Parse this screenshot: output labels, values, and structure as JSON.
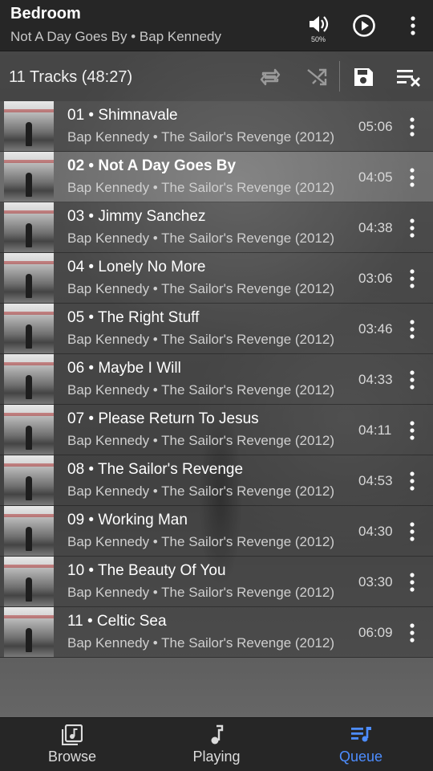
{
  "header": {
    "room": "Bedroom",
    "now_playing": "Not A Day Goes By • Bap Kennedy",
    "volume_percent": "50%",
    "icons": [
      "volume-icon",
      "play-icon",
      "more-vert-icon"
    ]
  },
  "queue": {
    "summary": "11 Tracks (48:27)",
    "icons": [
      "repeat-icon",
      "shuffle-icon",
      "save-icon",
      "clear-queue-icon"
    ]
  },
  "tracks": [
    {
      "title": "01 • Shimnavale",
      "subtitle": "Bap Kennedy • The Sailor's Revenge (2012)",
      "duration": "05:06"
    },
    {
      "title": "02 • Not A Day Goes By",
      "subtitle": "Bap Kennedy • The Sailor's Revenge (2012)",
      "duration": "04:05",
      "active": true
    },
    {
      "title": "03 • Jimmy Sanchez",
      "subtitle": "Bap Kennedy • The Sailor's Revenge (2012)",
      "duration": "04:38"
    },
    {
      "title": "04 • Lonely No More",
      "subtitle": "Bap Kennedy • The Sailor's Revenge (2012)",
      "duration": "03:06"
    },
    {
      "title": "05 • The Right Stuff",
      "subtitle": "Bap Kennedy • The Sailor's Revenge (2012)",
      "duration": "03:46"
    },
    {
      "title": "06 • Maybe I Will",
      "subtitle": "Bap Kennedy • The Sailor's Revenge (2012)",
      "duration": "04:33"
    },
    {
      "title": "07 • Please Return To Jesus",
      "subtitle": "Bap Kennedy • The Sailor's Revenge (2012)",
      "duration": "04:11"
    },
    {
      "title": "08 • The Sailor's Revenge",
      "subtitle": "Bap Kennedy • The Sailor's Revenge (2012)",
      "duration": "04:53"
    },
    {
      "title": "09 • Working Man",
      "subtitle": "Bap Kennedy • The Sailor's Revenge (2012)",
      "duration": "04:30"
    },
    {
      "title": "10 • The Beauty Of You",
      "subtitle": "Bap Kennedy • The Sailor's Revenge (2012)",
      "duration": "03:30"
    },
    {
      "title": "11 • Celtic Sea",
      "subtitle": "Bap Kennedy • The Sailor's Revenge (2012)",
      "duration": "06:09"
    }
  ],
  "nav": {
    "browse": "Browse",
    "playing": "Playing",
    "queue": "Queue",
    "active": "queue",
    "active_color": "#4d8dff"
  }
}
